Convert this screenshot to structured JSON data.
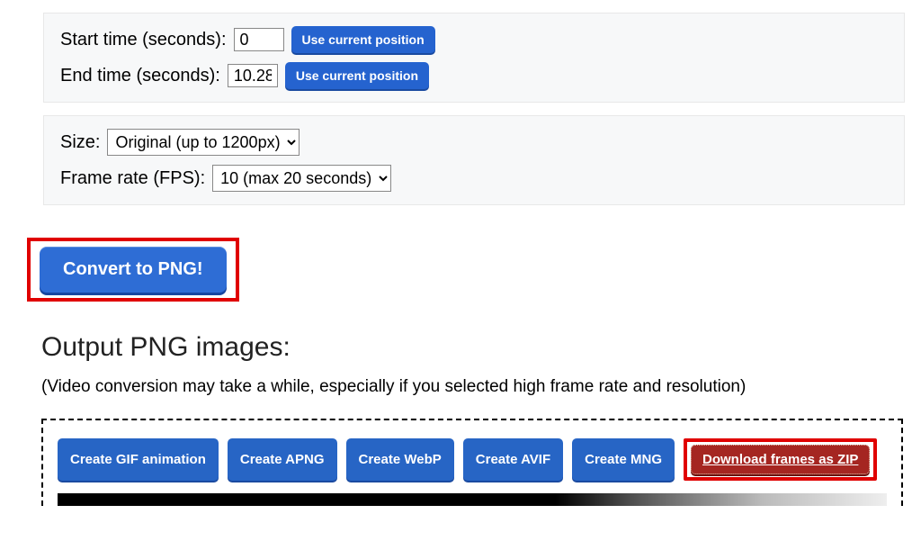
{
  "time_panel": {
    "start_label": "Start time (seconds):",
    "start_value": "0",
    "end_label": "End time (seconds):",
    "end_value": "10.28",
    "use_current": "Use current position"
  },
  "options_panel": {
    "size_label": "Size:",
    "size_value": "Original (up to 1200px)",
    "fps_label": "Frame rate (FPS):",
    "fps_value": "10 (max 20 seconds)"
  },
  "convert_button": "Convert to PNG!",
  "output": {
    "heading": "Output PNG images:",
    "note": "(Video conversion may take a while, especially if you selected high frame rate and resolution)"
  },
  "actions": {
    "gif": "Create GIF animation",
    "apng": "Create APNG",
    "webp": "Create WebP",
    "avif": "Create AVIF",
    "mng": "Create MNG",
    "zip": "Download frames as ZIP"
  }
}
